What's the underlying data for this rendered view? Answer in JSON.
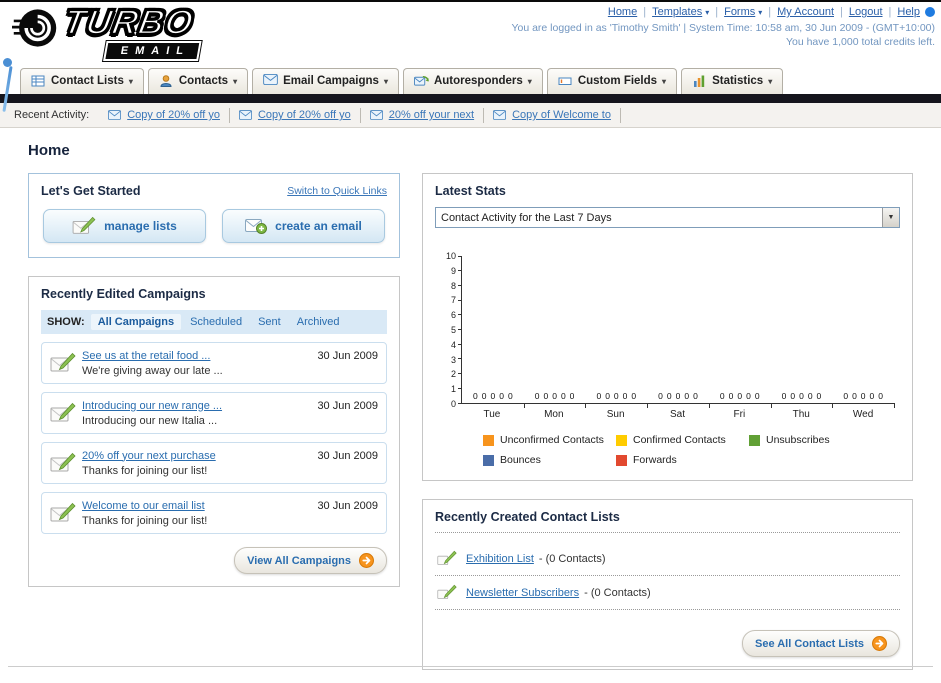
{
  "brand": {
    "name_top": "TURBO",
    "name_bottom": "EMAIL"
  },
  "header": {
    "links": [
      {
        "label": "Home",
        "dropdown": false
      },
      {
        "label": "Templates",
        "dropdown": true
      },
      {
        "label": "Forms",
        "dropdown": true
      },
      {
        "label": "My Account",
        "dropdown": false
      },
      {
        "label": "Logout",
        "dropdown": false
      },
      {
        "label": "Help",
        "dropdown": false
      }
    ],
    "login_info": "You are logged in as 'Timothy Smith' | System Time: 10:58 am, 30 Jun 2009 - (GMT+10:00)",
    "credits_info": "You have 1,000 total credits left."
  },
  "nav": {
    "items": [
      {
        "label": "Contact Lists"
      },
      {
        "label": "Contacts"
      },
      {
        "label": "Email Campaigns"
      },
      {
        "label": "Autoresponders"
      },
      {
        "label": "Custom Fields"
      },
      {
        "label": "Statistics"
      }
    ]
  },
  "recent_activity": {
    "label": "Recent Activity:",
    "items": [
      {
        "label": "Copy of 20% off yo"
      },
      {
        "label": "Copy of 20% off yo"
      },
      {
        "label": "20% off your next"
      },
      {
        "label": "Copy of Welcome to"
      }
    ]
  },
  "page": {
    "title": "Home"
  },
  "get_started": {
    "title": "Let's Get Started",
    "switch_link": "Switch to Quick Links",
    "manage_lists_label": "manage lists",
    "create_email_label": "create an email"
  },
  "campaigns": {
    "title": "Recently Edited Campaigns",
    "show_label": "SHOW:",
    "filters": [
      {
        "label": "All Campaigns",
        "selected": true
      },
      {
        "label": "Scheduled",
        "selected": false
      },
      {
        "label": "Sent",
        "selected": false
      },
      {
        "label": "Archived",
        "selected": false
      }
    ],
    "items": [
      {
        "title": "See us at the retail food ...",
        "subtitle": "We're giving away our late ...",
        "date": "30 Jun 2009"
      },
      {
        "title": "Introducing our new range ...",
        "subtitle": "Introducing our new Italia ...",
        "date": "30 Jun 2009"
      },
      {
        "title": "20% off your next purchase",
        "subtitle": "Thanks for joining our list!",
        "date": "30 Jun 2009"
      },
      {
        "title": "Welcome to our email list",
        "subtitle": "Thanks for joining our list!",
        "date": "30 Jun 2009"
      }
    ],
    "view_all_label": "View All Campaigns"
  },
  "stats": {
    "title": "Latest Stats",
    "period_selector": "Contact Activity for the Last 7 Days"
  },
  "chart_data": {
    "type": "bar",
    "title": "Contact Activity for the Last 7 Days",
    "categories": [
      "Tue",
      "Mon",
      "Sun",
      "Sat",
      "Fri",
      "Thu",
      "Wed"
    ],
    "series": [
      {
        "name": "Unconfirmed Contacts",
        "color": "#f7941d",
        "values": [
          0,
          0,
          0,
          0,
          0,
          0,
          0
        ]
      },
      {
        "name": "Confirmed Contacts",
        "color": "#ffcc00",
        "values": [
          0,
          0,
          0,
          0,
          0,
          0,
          0
        ]
      },
      {
        "name": "Unsubscribes",
        "color": "#61a035",
        "values": [
          0,
          0,
          0,
          0,
          0,
          0,
          0
        ]
      },
      {
        "name": "Bounces",
        "color": "#4a6da8",
        "values": [
          0,
          0,
          0,
          0,
          0,
          0,
          0
        ]
      },
      {
        "name": "Forwards",
        "color": "#e2492f",
        "values": [
          0,
          0,
          0,
          0,
          0,
          0,
          0
        ]
      }
    ],
    "ylim": [
      0,
      10
    ],
    "ytick_step": 1,
    "grid": false,
    "legend_position": "bottom",
    "bar_values_shown": true
  },
  "contact_lists": {
    "title": "Recently Created Contact Lists",
    "items": [
      {
        "name": "Exhibition List",
        "suffix": "- (0 Contacts)"
      },
      {
        "name": "Newsletter Subscribers",
        "suffix": "- (0 Contacts)"
      }
    ],
    "see_all_label": "See All Contact Lists"
  }
}
